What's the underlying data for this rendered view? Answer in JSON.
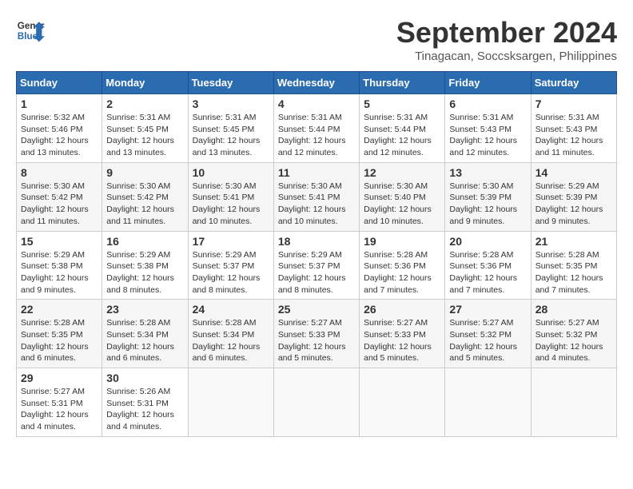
{
  "header": {
    "logo_text_general": "General",
    "logo_text_blue": "Blue",
    "month_title": "September 2024",
    "subtitle": "Tinagacan, Soccsksargen, Philippines"
  },
  "calendar": {
    "days_of_week": [
      "Sunday",
      "Monday",
      "Tuesday",
      "Wednesday",
      "Thursday",
      "Friday",
      "Saturday"
    ],
    "weeks": [
      [
        {
          "day": "",
          "info": ""
        },
        {
          "day": "2",
          "info": "Sunrise: 5:31 AM\nSunset: 5:45 PM\nDaylight: 12 hours\nand 13 minutes."
        },
        {
          "day": "3",
          "info": "Sunrise: 5:31 AM\nSunset: 5:45 PM\nDaylight: 12 hours\nand 13 minutes."
        },
        {
          "day": "4",
          "info": "Sunrise: 5:31 AM\nSunset: 5:44 PM\nDaylight: 12 hours\nand 12 minutes."
        },
        {
          "day": "5",
          "info": "Sunrise: 5:31 AM\nSunset: 5:44 PM\nDaylight: 12 hours\nand 12 minutes."
        },
        {
          "day": "6",
          "info": "Sunrise: 5:31 AM\nSunset: 5:43 PM\nDaylight: 12 hours\nand 12 minutes."
        },
        {
          "day": "7",
          "info": "Sunrise: 5:31 AM\nSunset: 5:43 PM\nDaylight: 12 hours\nand 11 minutes."
        }
      ],
      [
        {
          "day": "1",
          "info": "Sunrise: 5:32 AM\nSunset: 5:46 PM\nDaylight: 12 hours\nand 13 minutes."
        },
        {
          "day": "9",
          "info": "Sunrise: 5:30 AM\nSunset: 5:42 PM\nDaylight: 12 hours\nand 11 minutes."
        },
        {
          "day": "10",
          "info": "Sunrise: 5:30 AM\nSunset: 5:41 PM\nDaylight: 12 hours\nand 10 minutes."
        },
        {
          "day": "11",
          "info": "Sunrise: 5:30 AM\nSunset: 5:41 PM\nDaylight: 12 hours\nand 10 minutes."
        },
        {
          "day": "12",
          "info": "Sunrise: 5:30 AM\nSunset: 5:40 PM\nDaylight: 12 hours\nand 10 minutes."
        },
        {
          "day": "13",
          "info": "Sunrise: 5:30 AM\nSunset: 5:39 PM\nDaylight: 12 hours\nand 9 minutes."
        },
        {
          "day": "14",
          "info": "Sunrise: 5:29 AM\nSunset: 5:39 PM\nDaylight: 12 hours\nand 9 minutes."
        }
      ],
      [
        {
          "day": "8",
          "info": "Sunrise: 5:30 AM\nSunset: 5:42 PM\nDaylight: 12 hours\nand 11 minutes."
        },
        {
          "day": "16",
          "info": "Sunrise: 5:29 AM\nSunset: 5:38 PM\nDaylight: 12 hours\nand 8 minutes."
        },
        {
          "day": "17",
          "info": "Sunrise: 5:29 AM\nSunset: 5:37 PM\nDaylight: 12 hours\nand 8 minutes."
        },
        {
          "day": "18",
          "info": "Sunrise: 5:29 AM\nSunset: 5:37 PM\nDaylight: 12 hours\nand 8 minutes."
        },
        {
          "day": "19",
          "info": "Sunrise: 5:28 AM\nSunset: 5:36 PM\nDaylight: 12 hours\nand 7 minutes."
        },
        {
          "day": "20",
          "info": "Sunrise: 5:28 AM\nSunset: 5:36 PM\nDaylight: 12 hours\nand 7 minutes."
        },
        {
          "day": "21",
          "info": "Sunrise: 5:28 AM\nSunset: 5:35 PM\nDaylight: 12 hours\nand 7 minutes."
        }
      ],
      [
        {
          "day": "15",
          "info": "Sunrise: 5:29 AM\nSunset: 5:38 PM\nDaylight: 12 hours\nand 9 minutes."
        },
        {
          "day": "23",
          "info": "Sunrise: 5:28 AM\nSunset: 5:34 PM\nDaylight: 12 hours\nand 6 minutes."
        },
        {
          "day": "24",
          "info": "Sunrise: 5:28 AM\nSunset: 5:34 PM\nDaylight: 12 hours\nand 6 minutes."
        },
        {
          "day": "25",
          "info": "Sunrise: 5:27 AM\nSunset: 5:33 PM\nDaylight: 12 hours\nand 5 minutes."
        },
        {
          "day": "26",
          "info": "Sunrise: 5:27 AM\nSunset: 5:33 PM\nDaylight: 12 hours\nand 5 minutes."
        },
        {
          "day": "27",
          "info": "Sunrise: 5:27 AM\nSunset: 5:32 PM\nDaylight: 12 hours\nand 5 minutes."
        },
        {
          "day": "28",
          "info": "Sunrise: 5:27 AM\nSunset: 5:32 PM\nDaylight: 12 hours\nand 4 minutes."
        }
      ],
      [
        {
          "day": "22",
          "info": "Sunrise: 5:28 AM\nSunset: 5:35 PM\nDaylight: 12 hours\nand 6 minutes."
        },
        {
          "day": "30",
          "info": "Sunrise: 5:26 AM\nSunset: 5:31 PM\nDaylight: 12 hours\nand 4 minutes."
        },
        {
          "day": "",
          "info": ""
        },
        {
          "day": "",
          "info": ""
        },
        {
          "day": "",
          "info": ""
        },
        {
          "day": "",
          "info": ""
        },
        {
          "day": ""
        }
      ],
      [
        {
          "day": "29",
          "info": "Sunrise: 5:27 AM\nSunset: 5:31 PM\nDaylight: 12 hours\nand 4 minutes."
        },
        {
          "day": "",
          "info": ""
        },
        {
          "day": "",
          "info": ""
        },
        {
          "day": "",
          "info": ""
        },
        {
          "day": "",
          "info": ""
        },
        {
          "day": "",
          "info": ""
        },
        {
          "day": "",
          "info": ""
        }
      ]
    ]
  }
}
